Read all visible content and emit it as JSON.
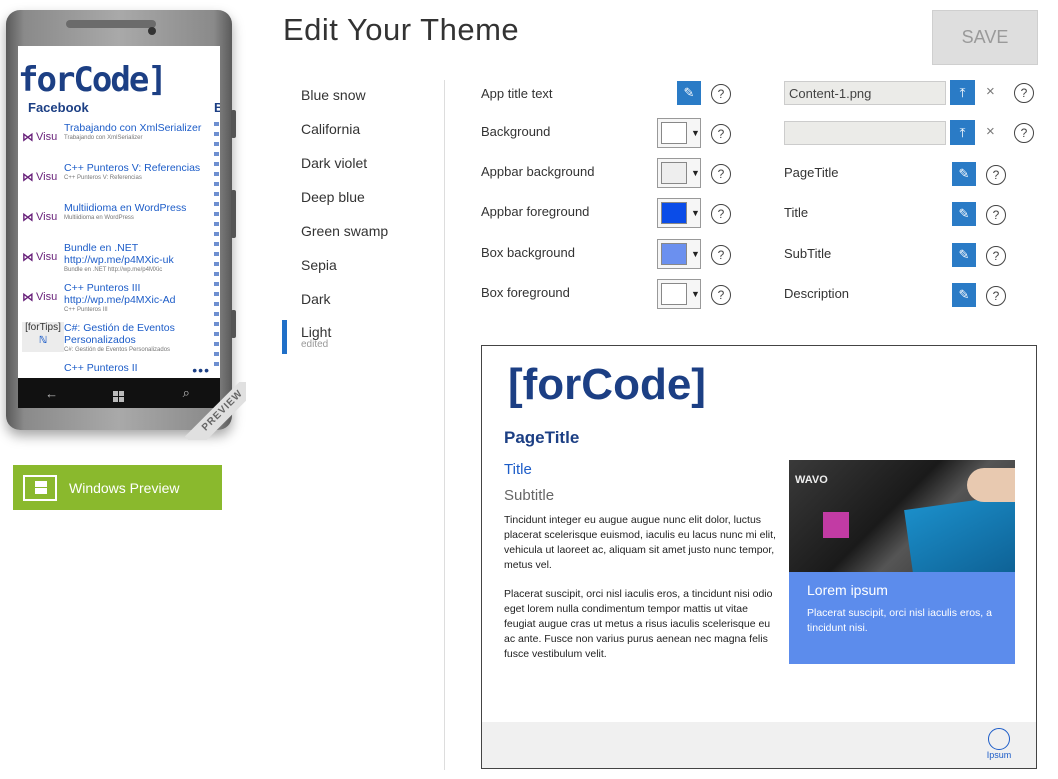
{
  "phone": {
    "app_title": "forCode]",
    "section": "Facebook",
    "section2": "B",
    "items": [
      {
        "thumb": "Visu",
        "title": "Trabajando con XmlSerializer",
        "sub": "Trabajando con XmlSerializer"
      },
      {
        "thumb": "Visu",
        "title": "C++ Punteros V: Referencias",
        "sub": "C++ Punteros V: Referencias"
      },
      {
        "thumb": "Visu",
        "title": "Multiidioma en WordPress",
        "sub": "Multiidioma en WordPress"
      },
      {
        "thumb": "Visu",
        "title": "Bundle en .NET http://wp.me/p4MXic-uk",
        "sub": "Bundle en .NET http://wp.me/p4MXic"
      },
      {
        "thumb": "Visu",
        "title": "C++ Punteros III http://wp.me/p4MXic-Ad",
        "sub": "C++ Punteros III"
      },
      {
        "thumb": "[forTips]",
        "title": "C#: Gestión de Eventos Personalizados",
        "sub": "C#: Gestión de Eventos Personalizados"
      },
      {
        "thumb": "",
        "title": "C++ Punteros II",
        "sub": ""
      }
    ],
    "dots": "•••",
    "ribbon": "PREVIEW"
  },
  "windows_preview": {
    "label": "Windows Preview"
  },
  "header": {
    "title": "Edit Your Theme",
    "save_label": "SAVE"
  },
  "themes": [
    {
      "name": "Blue snow"
    },
    {
      "name": "California"
    },
    {
      "name": "Dark violet"
    },
    {
      "name": "Deep blue"
    },
    {
      "name": "Green swamp"
    },
    {
      "name": "Sepia"
    },
    {
      "name": "Dark"
    },
    {
      "name": "Light",
      "note": "edited",
      "active": true
    }
  ],
  "settings": {
    "app_title_text": "App title text",
    "background": "Background",
    "appbar_background": "Appbar background",
    "appbar_foreground": "Appbar foreground",
    "box_background": "Box background",
    "box_foreground": "Box foreground",
    "help": "?",
    "colors": {
      "background": "#ffffff",
      "appbar_background": "#eeeeee",
      "appbar_foreground": "#0a4ce8",
      "box_background": "#6b90ef",
      "box_foreground": "#ffffff"
    }
  },
  "right": {
    "file1_value": "Content-1.png",
    "file2_value": "",
    "clear": "×",
    "page_title": "PageTitle",
    "title": "Title",
    "subtitle": "SubTitle",
    "description": "Description"
  },
  "content": {
    "logo": "[forCode]",
    "page_title": "PageTitle",
    "title": "Title",
    "subtitle": "Subtitle",
    "para1": "Tincidunt integer eu augue augue nunc elit dolor, luctus placerat scelerisque euismod, iaculis eu lacus nunc mi elit, vehicula ut laoreet ac, aliquam sit amet justo nunc tempor, metus vel.",
    "para2": "Placerat suscipit, orci nisl iaculis eros, a tincidunt nisi odio eget lorem nulla condimentum tempor mattis ut vitae feugiat augue cras ut metus a risus iaculis scelerisque eu ac ante. Fusce non varius purus aenean nec magna felis fusce vestibulum velit.",
    "image_text": "WAVO",
    "box_title": "Lorem ipsum",
    "box_text": "Placerat suscipit, orci nisl iaculis eros, a tincidunt nisi.",
    "appbar_label": "Ipsum"
  }
}
